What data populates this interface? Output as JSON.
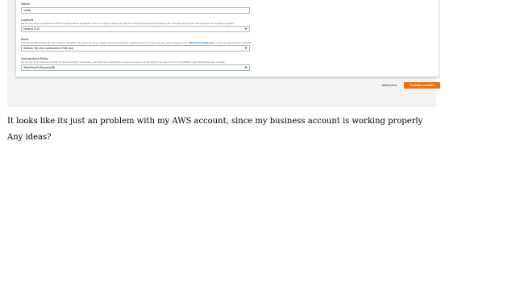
{
  "form": {
    "name": {
      "label": "Name",
      "value": "netlify"
    },
    "runtime": {
      "label": "Laufzeit",
      "description": "Sie können einen unterstützten AWS Lambda-Laufzeit auswählen oder eine eigene Laufzeit als Teil des Funktionsbereitstellungspakets oder Lambda-Layers nach dem Erstellen der Funktion angeben.",
      "value": "Node.js 8.10"
    },
    "role": {
      "label": "Rolle",
      "description_prefix": "Definiert die Berechtigungen der Funktion. Beachten Sie, dass die neuen Rollen nach der Erstellung möglicherweise für einige Minuten nicht verfügbar sind.",
      "description_link": "Weitere Informationen",
      "description_suffix": "zu den Lambda-Ausführungsrollen.",
      "value": "Wählen Sie eine vorhandene Rolle aus"
    },
    "existing_role": {
      "label": "Vorhandene Rolle",
      "description": "Sie können eine vorhandene Rolle mit dieser Funktion verwenden. Lambda muss diese Rolle annehmen können und die Rolle muss über Amazon CloudWatch Logs-Berechtigungen verfügen.",
      "value": "WriteReadToDynamoDB"
    }
  },
  "actions": {
    "cancel_label": "Abbrechen",
    "create_label": "Funktion erstellen"
  },
  "post": {
    "line1": "It looks like its just an problem with my AWS account, since my business account is working properly",
    "line2": "Any ideas?"
  }
}
